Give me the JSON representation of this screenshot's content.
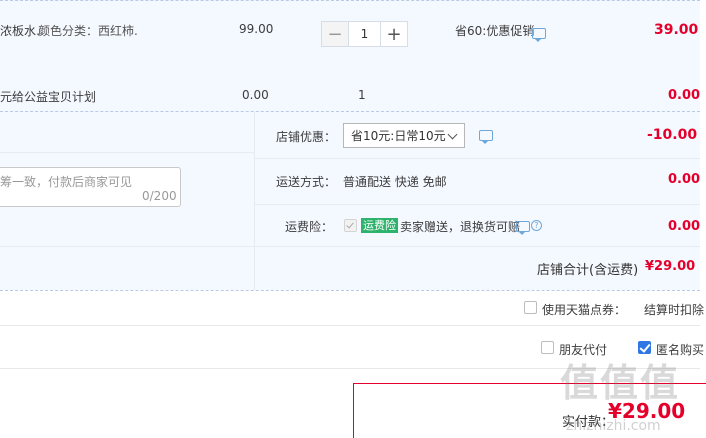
{
  "item": {
    "title_partial": "浓板水…",
    "attr": "颜色分类：西红柿.",
    "unit_price": "99.00",
    "quantity": "1",
    "promo": "省60:优惠促销",
    "subtotal": "39.00"
  },
  "charity": {
    "label": "元给公益宝贝计划",
    "price": "0.00",
    "quantity": "1",
    "subtotal": "0.00"
  },
  "shop": {
    "discount_label": "店铺优惠：",
    "discount_select": "省10元:日常10元",
    "discount_value": "-10.00",
    "message_placeholder": "筹一致，付款后商家可见",
    "message_count": "0/200",
    "shipping_label": "运送方式：",
    "shipping_options": "普通配送 快递 免邮",
    "shipping_value": "0.00",
    "insurance_label": "运费险：",
    "insurance_badge": "运费险",
    "insurance_text": "卖家赠送，退换货可赔",
    "insurance_value": "0.00",
    "total_label": "店铺合计(含运费)",
    "total_value": "¥29.00"
  },
  "options": {
    "tmall_points_label": "使用天猫点券：",
    "tmall_points_note": "结算时扣除",
    "friend_pay_label": "朋友代付",
    "anonymous_label": "匿名购买"
  },
  "payment": {
    "label": "实付款：",
    "amount": "¥29.00"
  },
  "watermark": {
    "big": "值值值",
    "small": "zhizhizhi.com"
  },
  "colors": {
    "accent_red": "#e4002b",
    "checkbox_blue": "#2f77e5",
    "badge_green": "#2db36b"
  }
}
